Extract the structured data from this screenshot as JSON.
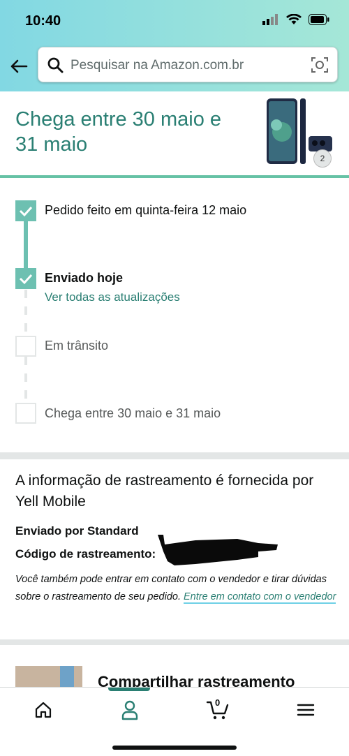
{
  "status": {
    "time": "10:40"
  },
  "search": {
    "placeholder": "Pesquisar na Amazon.com.br"
  },
  "arrival": {
    "title": "Chega entre 30 maio e 31 maio",
    "quantity": "2"
  },
  "timeline": {
    "steps": [
      {
        "label": "Pedido feito em quinta-feira 12 maio",
        "done": true
      },
      {
        "label": "Enviado hoje",
        "done": true,
        "link": "Ver todas as atualizações"
      },
      {
        "label": "Em trânsito",
        "done": false
      },
      {
        "label": "Chega entre 30 maio e 31 maio",
        "done": false
      }
    ]
  },
  "tracking": {
    "title": "A informação de rastreamento é fornecida por Yell Mobile",
    "shipped_by": "Enviado por Standard",
    "code_label": "Código de rastreamento:",
    "note": "Você também pode entrar em contato com o vendedor e tirar dúvidas sobre o rastreamento de seu pedido. ",
    "contact_link": "Entre em contato com o vendedor"
  },
  "share": {
    "title": "Compartilhar rastreamento"
  },
  "nav": {
    "cart_count": "0"
  },
  "colors": {
    "accent": "#2a7f73",
    "done": "#6dc0b1",
    "header_from": "#82d8e3",
    "header_to": "#a5e7d7"
  }
}
